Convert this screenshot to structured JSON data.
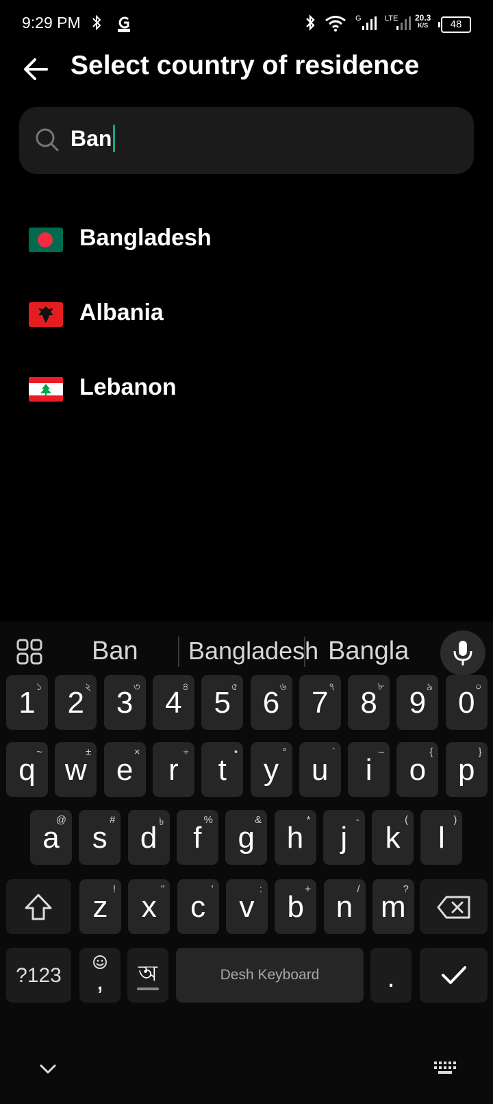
{
  "status_bar": {
    "time": "9:29 PM",
    "network_g": "G",
    "network_lte": "LTE",
    "speed_value": "20.3",
    "speed_unit": "K/S",
    "battery": "48"
  },
  "header": {
    "title": "Select country of residence"
  },
  "search": {
    "value": "Ban"
  },
  "countries": [
    {
      "name": "Bangladesh"
    },
    {
      "name": "Albania"
    },
    {
      "name": "Lebanon"
    }
  ],
  "keyboard": {
    "suggestions": [
      "Ban",
      "Bangladesh",
      "Bangla"
    ],
    "row1": [
      {
        "k": "1",
        "s": "১"
      },
      {
        "k": "2",
        "s": "২"
      },
      {
        "k": "3",
        "s": "৩"
      },
      {
        "k": "4",
        "s": "৪"
      },
      {
        "k": "5",
        "s": "৫"
      },
      {
        "k": "6",
        "s": "৬"
      },
      {
        "k": "7",
        "s": "৭"
      },
      {
        "k": "8",
        "s": "৮"
      },
      {
        "k": "9",
        "s": "৯"
      },
      {
        "k": "0",
        "s": "০"
      }
    ],
    "row2": [
      {
        "k": "q",
        "s": "~"
      },
      {
        "k": "w",
        "s": "±"
      },
      {
        "k": "e",
        "s": "×"
      },
      {
        "k": "r",
        "s": "÷"
      },
      {
        "k": "t",
        "s": "•"
      },
      {
        "k": "y",
        "s": "°"
      },
      {
        "k": "u",
        "s": "`"
      },
      {
        "k": "i",
        "s": "–"
      },
      {
        "k": "o",
        "s": "{"
      },
      {
        "k": "p",
        "s": "}"
      }
    ],
    "row3": [
      {
        "k": "a",
        "s": "@"
      },
      {
        "k": "s",
        "s": "#"
      },
      {
        "k": "d",
        "s": "৳"
      },
      {
        "k": "f",
        "s": "%"
      },
      {
        "k": "g",
        "s": "&"
      },
      {
        "k": "h",
        "s": "*"
      },
      {
        "k": "j",
        "s": "-"
      },
      {
        "k": "k",
        "s": "("
      },
      {
        "k": "l",
        "s": ")"
      }
    ],
    "row4": [
      {
        "k": "z",
        "s": "!"
      },
      {
        "k": "x",
        "s": "\""
      },
      {
        "k": "c",
        "s": "'"
      },
      {
        "k": "v",
        "s": ":"
      },
      {
        "k": "b",
        "s": "+"
      },
      {
        "k": "n",
        "s": "/"
      },
      {
        "k": "m",
        "s": "?"
      }
    ],
    "symbols_label": "?123",
    "comma": ",",
    "bangla_label": "অ",
    "space_label": "Desh Keyboard",
    "period": "."
  },
  "icons": {
    "back": "arrow-left-icon",
    "search": "search-icon",
    "mic": "mic-icon",
    "shift": "shift-icon",
    "backspace": "backspace-icon",
    "enter": "checkmark-icon"
  },
  "colors": {
    "accent": "#1aa38a",
    "background": "#000000",
    "key": "#262626"
  }
}
